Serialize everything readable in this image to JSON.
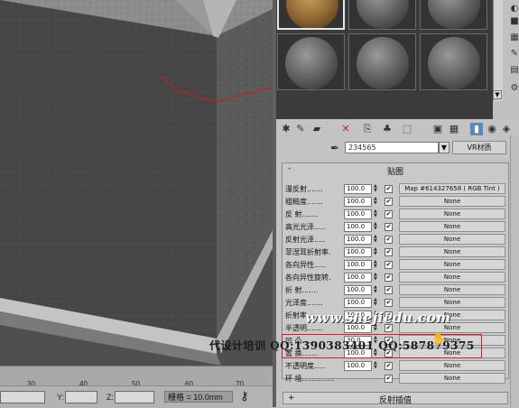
{
  "viewport": {
    "ruler_ticks": [
      "30",
      "40",
      "50",
      "60",
      "70"
    ],
    "coord_labels": {
      "y": "Y:",
      "z": "Z:"
    },
    "grid_label": "栅格 = 10.0mm"
  },
  "material_editor": {
    "material_name": "234565",
    "material_type": "VR材质",
    "maps_rollout_title": "贴图",
    "rows": [
      {
        "label": "漫反射.......",
        "value": "100.0",
        "checked": true,
        "map": "Map #614327658  ( RGB Tint )"
      },
      {
        "label": "粗糙度.......",
        "value": "100.0",
        "checked": true,
        "map": "None"
      },
      {
        "label": "反  射.......",
        "value": "100.0",
        "checked": true,
        "map": "None"
      },
      {
        "label": "高光光泽.....",
        "value": "100.0",
        "checked": true,
        "map": "None"
      },
      {
        "label": "反射光泽.....",
        "value": "100.0",
        "checked": true,
        "map": "None"
      },
      {
        "label": "菲涅耳折射率.",
        "value": "100.0",
        "checked": true,
        "map": "None"
      },
      {
        "label": "各向异性.....",
        "value": "100.0",
        "checked": true,
        "map": "None"
      },
      {
        "label": "各向异性旋转.",
        "value": "100.0",
        "checked": true,
        "map": "None"
      },
      {
        "label": "折  射.......",
        "value": "100.0",
        "checked": true,
        "map": "None"
      },
      {
        "label": "光泽度.......",
        "value": "100.0",
        "checked": true,
        "map": "None"
      },
      {
        "label": "折射率.......",
        "value": "100.0",
        "checked": true,
        "map": "None"
      },
      {
        "label": "半透明.......",
        "value": "100.0",
        "checked": true,
        "map": "None"
      },
      {
        "label": "凹  凸.......",
        "value": "30.0",
        "checked": true,
        "map": "None"
      },
      {
        "label": "置  换.......",
        "value": "100.0",
        "checked": true,
        "map": "None"
      },
      {
        "label": "不透明度.....",
        "value": "100.0",
        "checked": true,
        "map": "None"
      },
      {
        "label": "环  境..............",
        "value": "",
        "checked": true,
        "map": "None"
      }
    ],
    "reflect_rollout_title": "反射插值"
  },
  "watermark": {
    "site": "www.shejiedu.com",
    "ad_text": "代设计培训 QQ:1390383401  QQ:587879375"
  }
}
